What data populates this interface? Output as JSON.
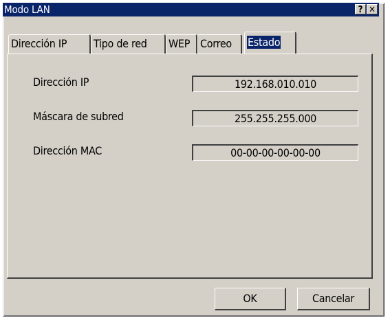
{
  "window": {
    "title": "Modo LAN",
    "help_button": "?",
    "close_button": "✕"
  },
  "tabs": [
    {
      "label": "Dirección IP",
      "active": false
    },
    {
      "label": "Tipo de red",
      "active": false
    },
    {
      "label": "WEP",
      "active": false
    },
    {
      "label": "Correo",
      "active": false
    },
    {
      "label": "Estado",
      "active": true
    }
  ],
  "status": {
    "ip_label": "Dirección IP",
    "ip_value": "192.168.010.010",
    "mask_label": "Máscara de subred",
    "mask_value": "255.255.255.000",
    "mac_label": "Dirección MAC",
    "mac_value": "00-00-00-00-00-00"
  },
  "buttons": {
    "ok": "OK",
    "cancel": "Cancelar"
  },
  "colors": {
    "dialog_face": "#d4d0c8",
    "title_bar": "#0a246a",
    "selected_tab_highlight": "#0a246a"
  }
}
